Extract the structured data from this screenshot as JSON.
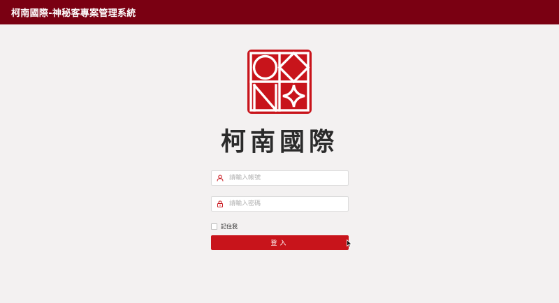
{
  "header": {
    "title": "柯南國際-神秘客專案管理系統"
  },
  "brand": {
    "name": "柯南國際",
    "logo_icon": "okmc-logo-icon",
    "accent_color": "#c8141b"
  },
  "login": {
    "username_placeholder": "請輸入帳號",
    "password_placeholder": "請輸入密碼",
    "user_icon": "user-icon",
    "lock_icon": "lock-icon",
    "remember_label": "記住我",
    "remember_checked": false,
    "submit_label": "登入"
  }
}
